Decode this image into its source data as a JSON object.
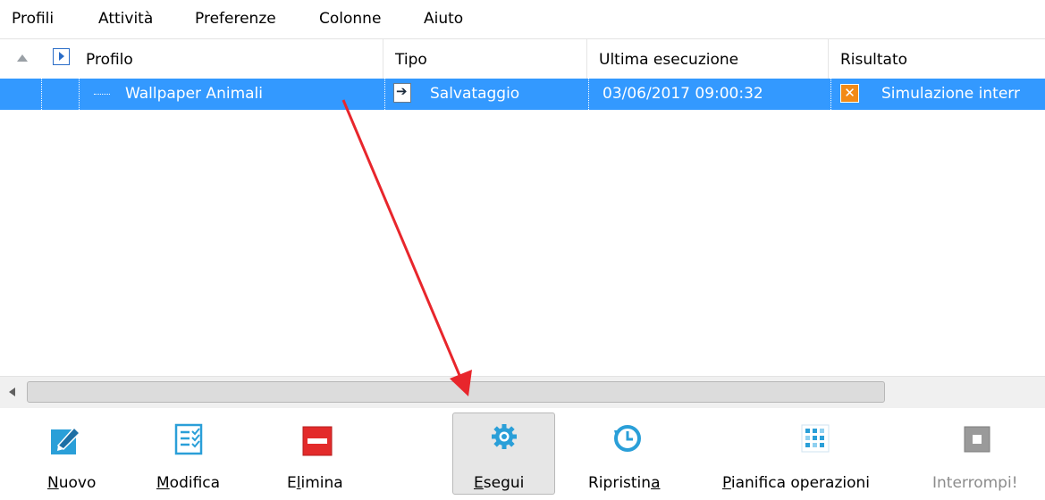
{
  "menu": [
    "Profili",
    "Attività",
    "Preferenze",
    "Colonne",
    "Aiuto"
  ],
  "columns": [
    "Profilo",
    "Tipo",
    "Ultima esecuzione",
    "Risultato"
  ],
  "row": {
    "profile": "Wallpaper Animali",
    "type": "Salvataggio",
    "last_run": "03/06/2017 09:00:32",
    "result": "Simulazione interr"
  },
  "result_icon_glyph": "✕",
  "toolbar": [
    {
      "label": "Nuovo",
      "underline_char": "N",
      "icon": "new-profile-icon"
    },
    {
      "label": "Modifica",
      "underline_char": "M",
      "icon": "edit-checklist-icon"
    },
    {
      "label": "Elimina",
      "underline_char": "l",
      "icon": "delete-icon"
    },
    {
      "label": "Esegui",
      "underline_char": "E",
      "icon": "gear-icon"
    },
    {
      "label": "Ripristina",
      "underline_char": "a",
      "icon": "restore-clock-icon"
    },
    {
      "label": "Pianifica operazioni",
      "underline_char": "P",
      "icon": "schedule-grid-icon"
    },
    {
      "label": "Interrompi!",
      "underline_char": "",
      "icon": "stop-icon",
      "disabled": true
    }
  ],
  "colors": {
    "selection": "#3399ff",
    "accent_blue": "#2a9fd8",
    "delete_red": "#e32b2b",
    "result_orange": "#f28a17",
    "annotation_red": "#e8262c"
  }
}
